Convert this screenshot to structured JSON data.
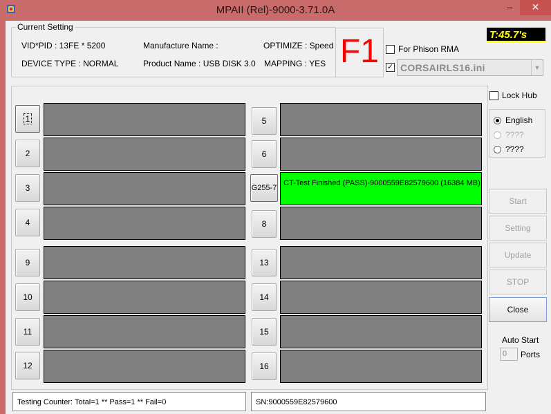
{
  "window": {
    "title": "MPAII (Rel)-9000-3.71.0A",
    "min_glyph": "–",
    "max_glyph": "□",
    "close_glyph": "✕"
  },
  "current_setting": {
    "group_title": "Current Setting",
    "vid_pid": "VID*PID : 13FE * 5200",
    "device_type": "DEVICE TYPE : NORMAL",
    "manufacture_name": "Manufacture Name :",
    "product_name": "Product Name : USB DISK 3.0",
    "optimize": "OPTIMIZE : Speed",
    "mapping": "MAPPING : YES"
  },
  "f1_label": "F1",
  "timer": "T:45.7's",
  "phison_rma": {
    "label": "For Phison RMA",
    "checked": false
  },
  "ini_file": {
    "checked": true,
    "value": "CORSAIRLS16.ini"
  },
  "lock_hub": {
    "label": "Lock Hub",
    "checked": false
  },
  "language": {
    "options": [
      {
        "label": "English",
        "selected": true,
        "enabled": true
      },
      {
        "label": "????",
        "selected": false,
        "enabled": false
      },
      {
        "label": "????",
        "selected": false,
        "enabled": true
      }
    ]
  },
  "ports": [
    {
      "button": "1",
      "status": "",
      "state": "idle"
    },
    {
      "button": "2",
      "status": "",
      "state": "idle"
    },
    {
      "button": "3",
      "status": "",
      "state": "idle"
    },
    {
      "button": "4",
      "status": "",
      "state": "idle"
    },
    {
      "button": "5",
      "status": "",
      "state": "idle"
    },
    {
      "button": "6",
      "status": "",
      "state": "idle"
    },
    {
      "button": "G255-7",
      "status": "CT-Test Finished (PASS)-9000559E82579600 (16384 MB)",
      "state": "pass"
    },
    {
      "button": "8",
      "status": "",
      "state": "idle"
    },
    {
      "button": "9",
      "status": "",
      "state": "idle"
    },
    {
      "button": "10",
      "status": "",
      "state": "idle"
    },
    {
      "button": "11",
      "status": "",
      "state": "idle"
    },
    {
      "button": "12",
      "status": "",
      "state": "idle"
    },
    {
      "button": "13",
      "status": "",
      "state": "idle"
    },
    {
      "button": "14",
      "status": "",
      "state": "idle"
    },
    {
      "button": "15",
      "status": "",
      "state": "idle"
    },
    {
      "button": "16",
      "status": "",
      "state": "idle"
    }
  ],
  "buttons": {
    "start": "Start",
    "setting": "Setting",
    "update": "Update",
    "stop": "STOP",
    "close": "Close"
  },
  "auto_start": {
    "label": "Auto Start",
    "value": "0",
    "unit": "Ports"
  },
  "status_bar": {
    "counter": "Testing Counter: Total=1 ** Pass=1 ** Fail=0",
    "sn": "SN:9000559E82579600"
  },
  "colors": {
    "title_bar": "#c96b6b",
    "pass": "#00ff00",
    "idle_slot": "#808080",
    "f1": "#ff0000",
    "timer_text": "#ffff00"
  }
}
